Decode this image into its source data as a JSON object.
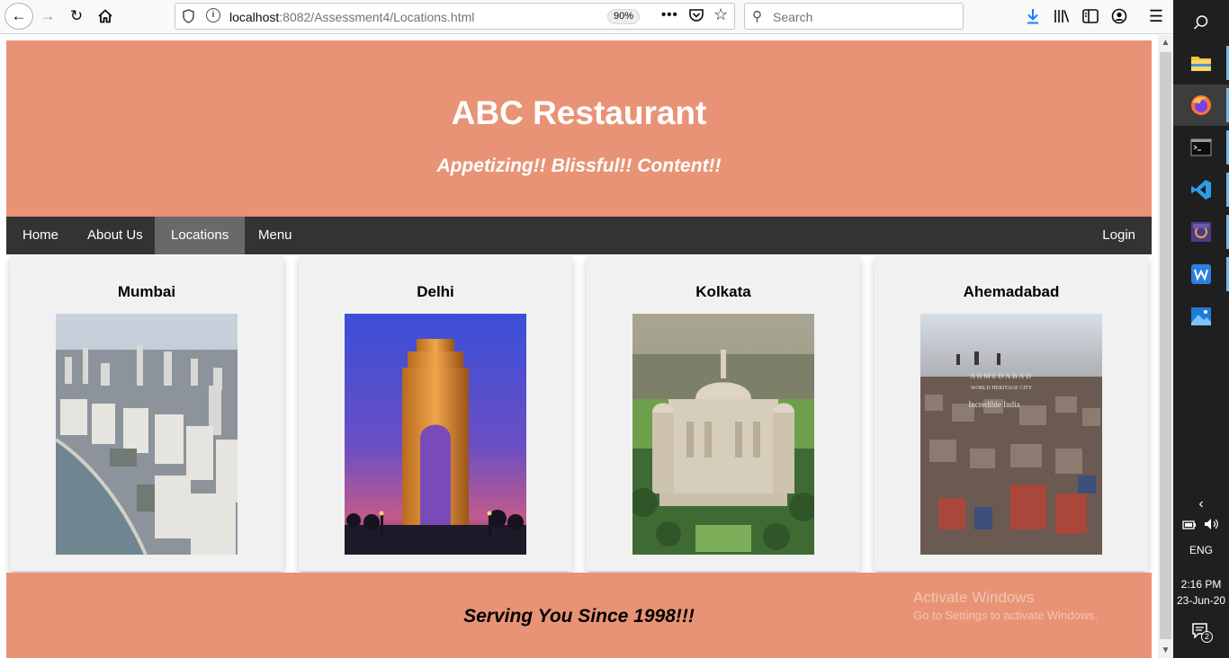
{
  "browser": {
    "url_host": "localhost",
    "url_rest": ":8082/Assessment4/Locations.html",
    "zoom": "90%",
    "search_placeholder": "Search"
  },
  "header": {
    "title": "ABC Restaurant",
    "tagline": "Appetizing!! Blissful!! Content!!"
  },
  "nav": {
    "items": [
      {
        "label": "Home",
        "active": false
      },
      {
        "label": "About Us",
        "active": false
      },
      {
        "label": "Locations",
        "active": true
      },
      {
        "label": "Menu",
        "active": false
      }
    ],
    "login": "Login"
  },
  "locations": [
    {
      "city": "Mumbai",
      "image": "mumbai-skyline-photo"
    },
    {
      "city": "Delhi",
      "image": "india-gate-photo"
    },
    {
      "city": "Kolkata",
      "image": "victoria-memorial-photo"
    },
    {
      "city": "Ahemadabad",
      "image": "ahmedabad-city-photo"
    }
  ],
  "ahmedabad_image_text": {
    "line1": "AHMEDABAD",
    "line2": "WORLD HERITAGE CITY",
    "line3": "Incredible India"
  },
  "footer": {
    "text": "Serving You Since 1998!!!"
  },
  "watermark": {
    "title": "Activate Windows",
    "subtitle": "Go to Settings to activate Windows."
  },
  "taskbar": {
    "language": "ENG",
    "time": "2:16 PM",
    "date": "23-Jun-20",
    "notifications": "2"
  },
  "colors": {
    "banner": "#e99376",
    "navbar": "#333333",
    "nav_active": "#696969",
    "card": "#f1f1f1"
  }
}
